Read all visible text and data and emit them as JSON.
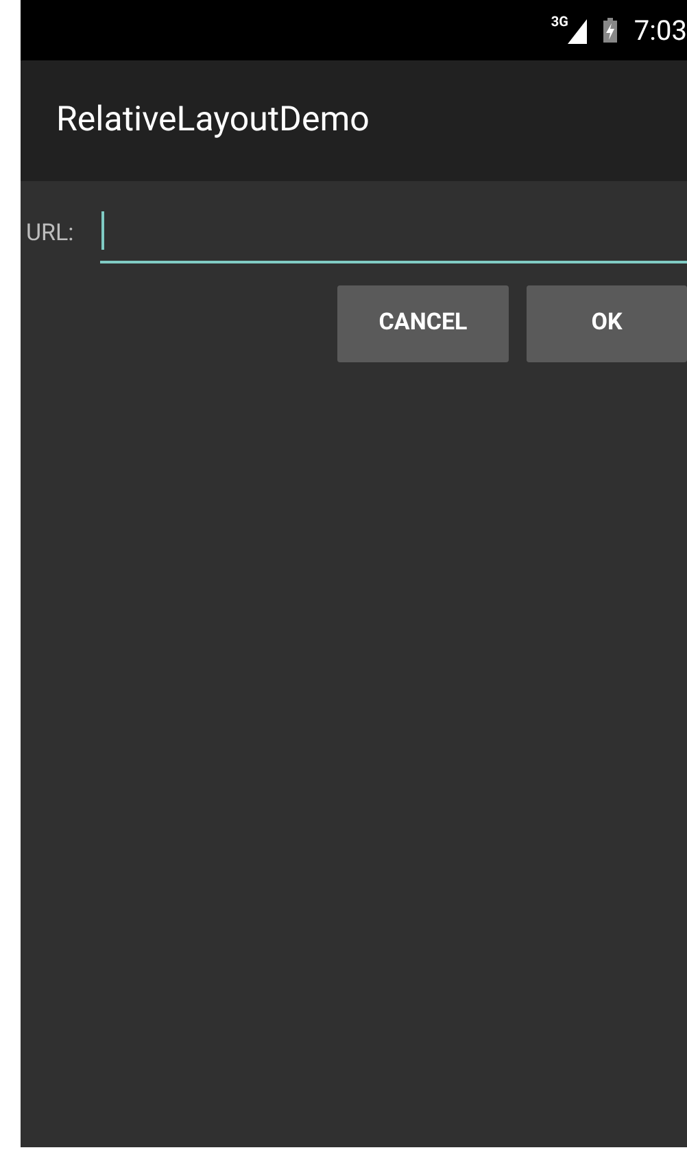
{
  "status_bar": {
    "network": "3G",
    "time": "7:03",
    "charging": true
  },
  "app_bar": {
    "title": "RelativeLayoutDemo"
  },
  "form": {
    "label": "URL:",
    "field": {
      "focused": true
    }
  },
  "buttons": [
    {
      "label": "CANCEL"
    },
    {
      "label": "OK"
    }
  ]
}
